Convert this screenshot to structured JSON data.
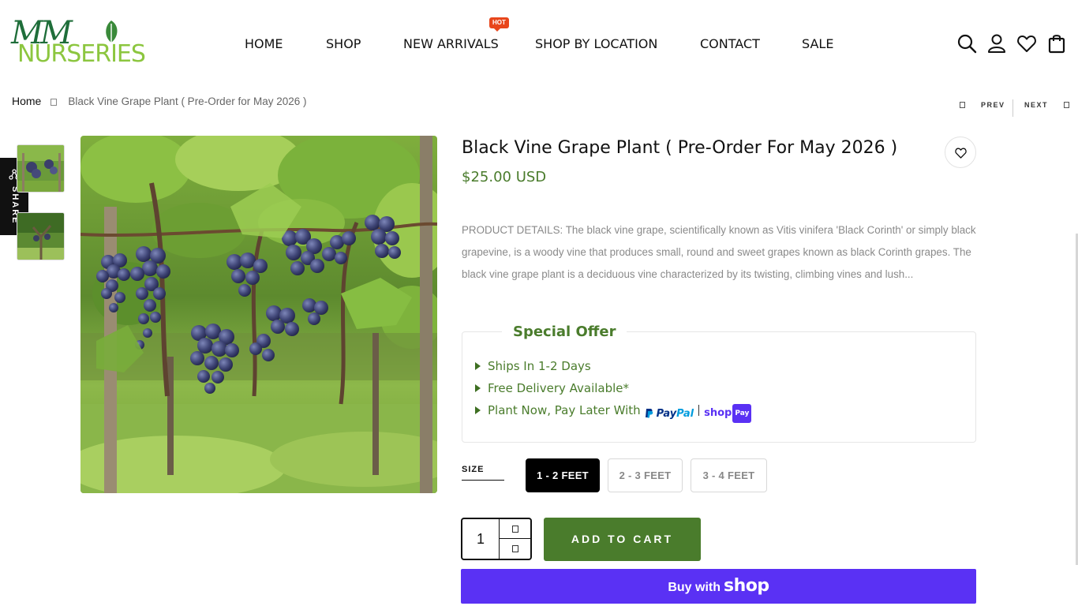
{
  "logo": {
    "top_text": "MM",
    "bottom_text": "NURSERIES"
  },
  "nav": {
    "items": [
      {
        "label": "HOME"
      },
      {
        "label": "SHOP"
      },
      {
        "label": "NEW ARRIVALS",
        "badge": "HOT"
      },
      {
        "label": "SHOP BY LOCATION"
      },
      {
        "label": "CONTACT"
      },
      {
        "label": "SALE"
      }
    ]
  },
  "header_icons": [
    "search-icon",
    "account-icon",
    "heart-icon",
    "cart-icon"
  ],
  "breadcrumb": {
    "home": "Home",
    "current": "Black Vine Grape Plant ( Pre-Order for May 2026 )"
  },
  "pager": {
    "prev": "PREV",
    "next": "NEXT"
  },
  "share": {
    "label": "SHARE"
  },
  "product": {
    "title": "Black Vine Grape Plant ( Pre-Order For May 2026 )",
    "price": "$25.00 USD",
    "description": "PRODUCT DETAILS: The black vine grape, scientifically known as Vitis vinifera 'Black Corinth' or simply black grapevine, is a woody vine that produces small, round and sweet grapes known as black Corinth grapes. The black vine grape plant is a deciduous vine characterized by its twisting, climbing vines and lush..."
  },
  "special_offer": {
    "title": "Special Offer",
    "items": [
      "Ships In 1-2 Days",
      "Free Delivery Available*",
      "Plant Now, Pay Later With"
    ],
    "paypal_p1": "Pay",
    "paypal_p2": "Pal",
    "shop_word": "shop",
    "shop_pay_badge": "Pay"
  },
  "size": {
    "label": "SIZE",
    "options": [
      "1 - 2 FEET",
      "2 - 3 FEET",
      "3 - 4 FEET"
    ],
    "selected": "1 - 2 FEET"
  },
  "cart": {
    "quantity": "1",
    "add_label": "ADD TO CART",
    "buy_with": "Buy with",
    "buy_shop": "shop"
  },
  "colors": {
    "brand_green": "#4a7c2c",
    "shop_purple": "#5a31f4",
    "hot_badge": "#e8461b"
  }
}
